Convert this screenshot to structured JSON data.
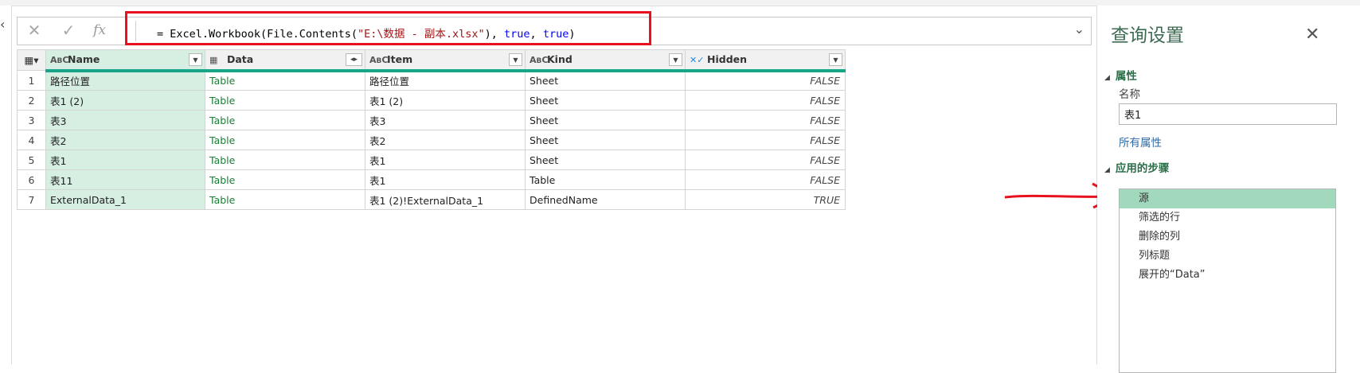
{
  "formula_bar": {
    "cancel_icon": "close-icon",
    "commit_icon": "check-icon",
    "fx_label": "fx",
    "formula_prefix": "= Excel.Workbook(File.Contents(",
    "formula_string": "\"E:\\数据 - 副本.xlsx\"",
    "formula_sep1": "), ",
    "formula_true1": "true",
    "formula_sep2": ", ",
    "formula_true2": "true",
    "formula_suffix": ")"
  },
  "grid": {
    "columns": [
      {
        "label": "Name",
        "type_icon": "ABC"
      },
      {
        "label": "Data",
        "type_icon": "table-icon"
      },
      {
        "label": "Item",
        "type_icon": "ABC"
      },
      {
        "label": "Kind",
        "type_icon": "ABC"
      },
      {
        "label": "Hidden",
        "type_icon": "logical-icon"
      }
    ],
    "rows": [
      {
        "n": "1",
        "name": "路径位置",
        "data": "Table",
        "item": "路径位置",
        "kind": "Sheet",
        "hidden": "FALSE"
      },
      {
        "n": "2",
        "name": "表1 (2)",
        "data": "Table",
        "item": "表1 (2)",
        "kind": "Sheet",
        "hidden": "FALSE"
      },
      {
        "n": "3",
        "name": "表3",
        "data": "Table",
        "item": "表3",
        "kind": "Sheet",
        "hidden": "FALSE"
      },
      {
        "n": "4",
        "name": "表2",
        "data": "Table",
        "item": "表2",
        "kind": "Sheet",
        "hidden": "FALSE"
      },
      {
        "n": "5",
        "name": "表1",
        "data": "Table",
        "item": "表1",
        "kind": "Sheet",
        "hidden": "FALSE"
      },
      {
        "n": "6",
        "name": "表11",
        "data": "Table",
        "item": "表1",
        "kind": "Table",
        "hidden": "FALSE"
      },
      {
        "n": "7",
        "name": "ExternalData_1",
        "data": "Table",
        "item": "表1 (2)!ExternalData_1",
        "kind": "DefinedName",
        "hidden": "TRUE"
      }
    ]
  },
  "panel": {
    "title": "查询设置",
    "properties_header": "属性",
    "name_label": "名称",
    "name_value": "表1",
    "all_properties_link": "所有属性",
    "steps_header": "应用的步骤",
    "steps": [
      "源",
      "筛选的行",
      "删除的列",
      "列标题",
      "展开的“Data”"
    ],
    "active_step": "源"
  },
  "colors": {
    "highlight_box": "#e8121e",
    "header_underline": "#17a589",
    "name_column_fill": "#d7efe3",
    "active_step_fill": "#a2d9bd"
  }
}
